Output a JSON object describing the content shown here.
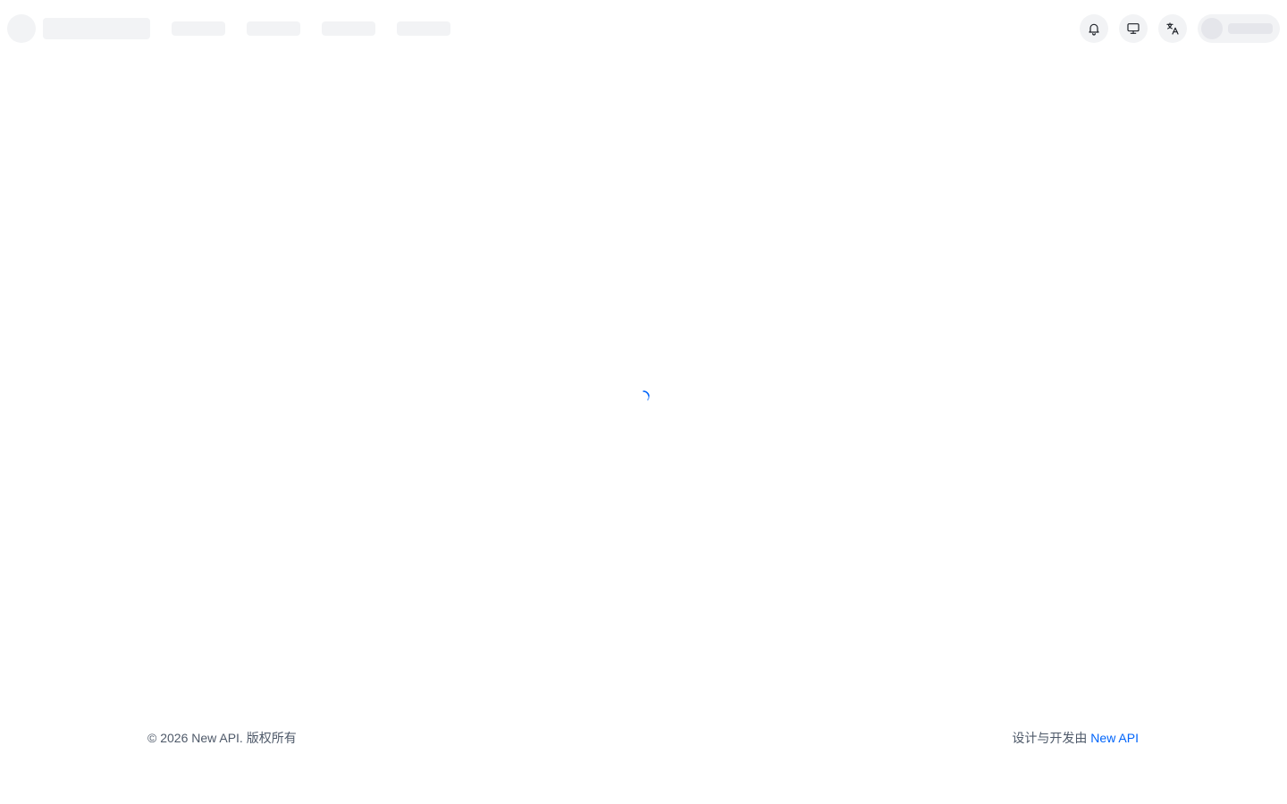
{
  "header": {
    "loading": true,
    "icons": {
      "notifications": "bell-icon",
      "theme": "monitor-icon",
      "language": "translate-icon"
    }
  },
  "main": {
    "state": "loading",
    "spinner_color": "#0064fa"
  },
  "footer": {
    "copyright": "© 2026 New API. 版权所有",
    "credit_prefix": "设计与开发由 ",
    "credit_link": "New API",
    "link_color": "#0064fa"
  }
}
